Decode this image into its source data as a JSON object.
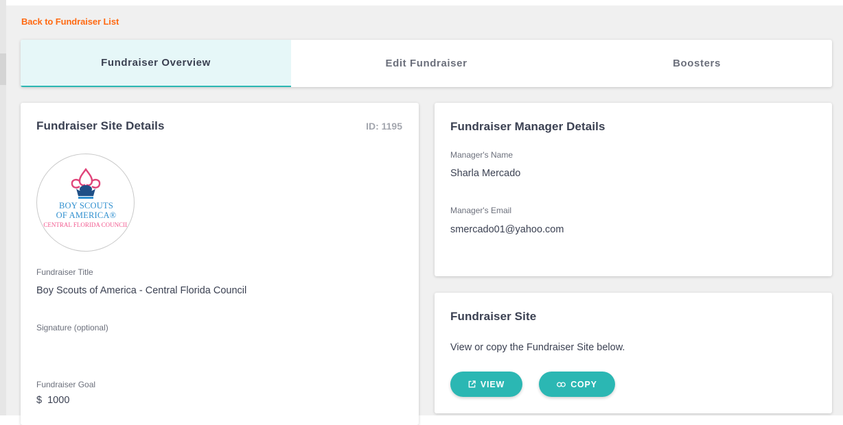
{
  "nav": {
    "back_link": "Back to Fundraiser List"
  },
  "tabs": [
    {
      "label": "Fundraiser Overview",
      "active": true
    },
    {
      "label": "Edit Fundraiser",
      "active": false
    },
    {
      "label": "Boosters",
      "active": false
    }
  ],
  "site_details": {
    "title": "Fundraiser Site Details",
    "id_label": "ID: 1195",
    "logo": {
      "line1": "BOY SCOUTS",
      "line2": "OF AMERICA®",
      "line3": "CENTRAL FLORIDA COUNCIL"
    },
    "fundraiser_title_label": "Fundraiser Title",
    "fundraiser_title_value": "Boy Scouts of America - Central Florida Council",
    "signature_label": "Signature (optional)",
    "signature_value": "",
    "goal_label": "Fundraiser Goal",
    "goal_value": "$  1000"
  },
  "manager": {
    "title": "Fundraiser Manager Details",
    "name_label": "Manager's Name",
    "name_value": "Sharla Mercado",
    "email_label": "Manager's Email",
    "email_value": "smercado01@yahoo.com"
  },
  "site": {
    "title": "Fundraiser Site",
    "description": "View or copy the Fundraiser Site below.",
    "view_label": "VIEW",
    "copy_label": "COPY"
  },
  "colors": {
    "accent_orange": "#ff6a13",
    "teal": "#2bb7b3",
    "active_tab_bg": "#e6f7f8",
    "logo_blue": "#2f8fcf",
    "logo_pink": "#f2598f"
  },
  "icons": {
    "view": "external-link-icon",
    "copy": "link-icon",
    "logo": "fleur-de-lis-emblem"
  }
}
